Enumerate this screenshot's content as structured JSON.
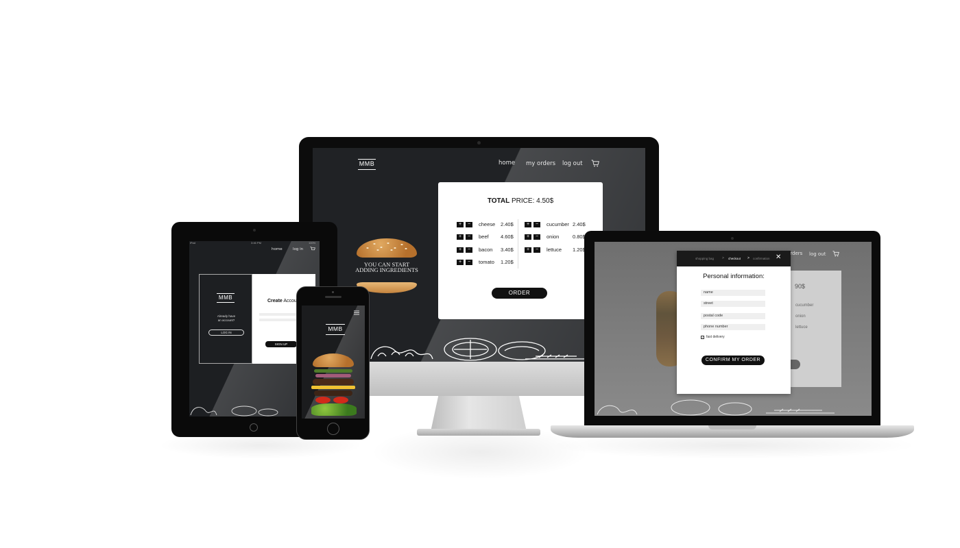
{
  "brand": {
    "logo": "MMB"
  },
  "desktop": {
    "nav": {
      "home": "home",
      "my_orders": "my orders",
      "log_out": "log out",
      "cart_icon": "cart-icon"
    },
    "hero": {
      "line1": "YOU CAN START",
      "line2": "ADDING INGREDIENTS"
    },
    "total": {
      "bold": "TOTAL",
      "rest": " PRICE: 4.50$"
    },
    "ingredients_left": [
      {
        "name": "cheese",
        "price": "2.40$"
      },
      {
        "name": "beef",
        "price": "4.60$"
      },
      {
        "name": "bacon",
        "price": "3.40$"
      },
      {
        "name": "tomato",
        "price": "1.20$"
      }
    ],
    "ingredients_right": [
      {
        "name": "cucumber",
        "price": "2.40$"
      },
      {
        "name": "onion",
        "price": "0.80$"
      },
      {
        "name": "lettuce",
        "price": "1.20$"
      }
    ],
    "plus": "+",
    "minus": "−",
    "order_button": "ORDER"
  },
  "tablet": {
    "status": {
      "left": "iPad",
      "center": "3:46 PM",
      "right": "100%"
    },
    "nav": {
      "home": "home",
      "log_in": "log in"
    },
    "side": {
      "already_line1": "Already have",
      "already_line2": "an account?",
      "login_button": "LOG IN"
    },
    "form": {
      "title_bold": "Create",
      "title_rest": " Accoun",
      "signup_button": "SIGN UP"
    }
  },
  "laptop": {
    "nav": {
      "orders": "orders",
      "log_out": "log out"
    },
    "bg_card": {
      "price": "90$",
      "items": [
        "cucumber",
        "onion",
        "lettuce"
      ]
    },
    "modal": {
      "steps": [
        "shopping bag",
        "checkout",
        "confirmation"
      ],
      "sep": ">",
      "close": "✕",
      "title": "Personal information:",
      "fields": [
        "name",
        "street",
        "postal code",
        "phone number"
      ],
      "checkbox_label": "fast delivery",
      "confirm_button": "CONFIRM MY ORDER"
    }
  },
  "phone": {
    "menu_icon": "hamburger-menu-icon"
  },
  "colors": {
    "dark_bg": "#202225",
    "accent": "#111111",
    "card": "#ffffff"
  }
}
